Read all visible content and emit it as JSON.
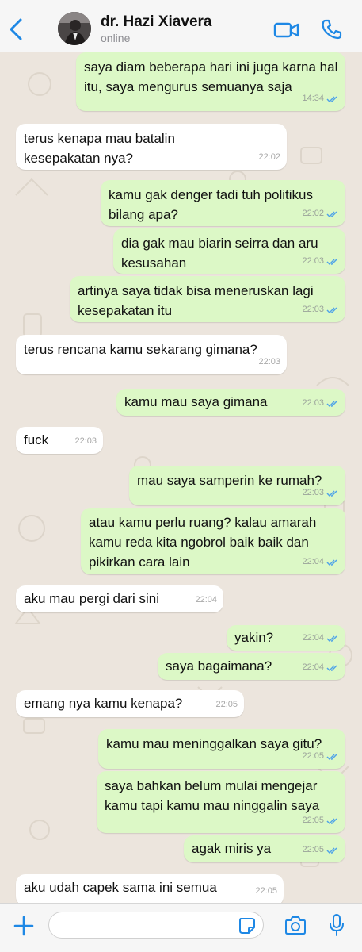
{
  "header": {
    "back_icon": "chevron-left-icon",
    "contact_name": "dr. Hazi Xiavera",
    "status": "online",
    "video_icon": "video-camera-icon",
    "call_icon": "phone-icon",
    "accent_color": "#1e88e5"
  },
  "messages": [
    {
      "dir": "out",
      "text": "saya diam beberapa hari ini juga karna hal itu, saya mengurus semuanya saja",
      "time": "14:34",
      "read": true
    },
    {
      "dir": "in",
      "text": "terus kenapa mau batalin kesepakatan nya?",
      "time": "22:02"
    },
    {
      "dir": "out",
      "text": "kamu gak denger tadi tuh politikus bilang apa?",
      "time": "22:02",
      "read": true
    },
    {
      "dir": "out",
      "text": "dia gak mau biarin seirra dan aru kesusahan",
      "time": "22:03",
      "read": true
    },
    {
      "dir": "out",
      "text": "artinya saya tidak bisa meneruskan lagi kesepakatan itu",
      "time": "22:03",
      "read": true
    },
    {
      "dir": "in",
      "text": "terus rencana kamu sekarang gimana?",
      "time": "22:03"
    },
    {
      "dir": "out",
      "text": "kamu mau saya gimana",
      "time": "22:03",
      "read": true
    },
    {
      "dir": "in",
      "text": "fuck",
      "time": "22:03"
    },
    {
      "dir": "out",
      "text": "mau saya samperin ke rumah?",
      "time": "22:03",
      "read": true
    },
    {
      "dir": "out",
      "text": "atau kamu perlu ruang? kalau amarah kamu reda kita ngobrol baik baik dan pikirkan cara lain",
      "time": "22:04",
      "read": true
    },
    {
      "dir": "in",
      "text": "aku mau pergi dari sini",
      "time": "22:04"
    },
    {
      "dir": "out",
      "text": "yakin?",
      "time": "22:04",
      "read": true
    },
    {
      "dir": "out",
      "text": "saya bagaimana?",
      "time": "22:04",
      "read": true
    },
    {
      "dir": "in",
      "text": "emang nya kamu kenapa?",
      "time": "22:05"
    },
    {
      "dir": "out",
      "text": "kamu mau meninggalkan saya gitu?",
      "time": "22:05",
      "read": true
    },
    {
      "dir": "out",
      "text": "saya bahkan belum mulai mengejar kamu tapi kamu mau ninggalin saya",
      "time": "22:05",
      "read": true
    },
    {
      "dir": "out",
      "text": "agak miris ya",
      "time": "22:05",
      "read": true
    },
    {
      "dir": "in",
      "text": "aku udah capek sama ini semua",
      "time": "22:05"
    }
  ],
  "composer": {
    "placeholder": "",
    "value": "",
    "plus_icon": "plus-icon",
    "sticker_icon": "sticker-icon",
    "camera_icon": "camera-icon",
    "mic_icon": "microphone-icon"
  },
  "colors": {
    "outgoing_bubble": "#dcf8c6",
    "incoming_bubble": "#ffffff",
    "read_ticks": "#4fa3e8",
    "chat_background": "#ece5dd"
  }
}
